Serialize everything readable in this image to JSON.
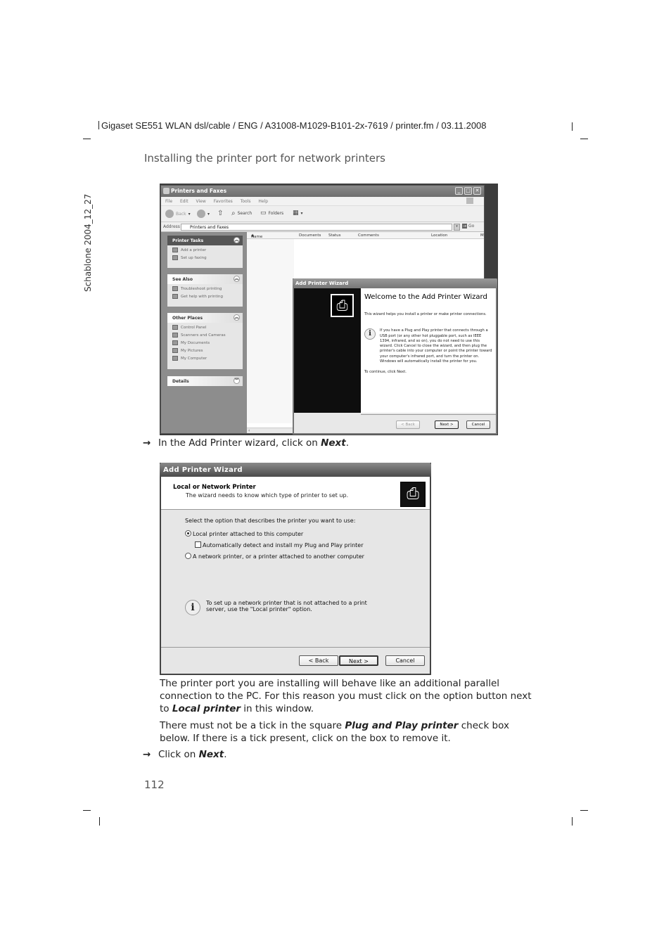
{
  "page_header": "Gigaset SE551 WLAN dsl/cable / ENG / A31008-M1029-B101-2x-7619 / printer.fm / 03.11.2008",
  "side_label": "Schablone 2004_12_27",
  "section_title": "Installing the printer port for network printers",
  "explorer": {
    "window_title": "Printers and Faxes",
    "menu": [
      "File",
      "Edit",
      "View",
      "Favorites",
      "Tools",
      "Help"
    ],
    "toolbar": {
      "back": "Back",
      "search": "Search",
      "folders": "Folders"
    },
    "address_label": "Address",
    "address_value": "Printers and Faxes",
    "go_label": "Go",
    "columns": [
      "Name",
      "Documents",
      "Status",
      "Comments",
      "Location",
      "M"
    ],
    "task_panes": [
      {
        "title": "Printer Tasks",
        "items": [
          "Add a printer",
          "Set up faxing"
        ]
      },
      {
        "title": "See Also",
        "items": [
          "Troubleshoot printing",
          "Get help with printing"
        ]
      },
      {
        "title": "Other Places",
        "items": [
          "Control Panel",
          "Scanners and Cameras",
          "My Documents",
          "My Pictures",
          "My Computer"
        ]
      },
      {
        "title": "Details",
        "items": []
      }
    ]
  },
  "welcome_wizard": {
    "title": "Add Printer Wizard",
    "heading": "Welcome to the Add Printer Wizard",
    "intro": "This wizard helps you install a printer or make printer connections.",
    "info": "If you have a Plug and Play printer that connects through a USB port (or any other hot pluggable port, such as IEEE 1394, infrared, and so on), you do not need to use this wizard. Click Cancel to close the wizard, and then plug the printer's cable into your computer or point the printer toward your computer's infrared port, and turn the printer on. Windows will automatically install the printer for you.",
    "continue": "To continue, click Next.",
    "buttons": {
      "back": "< Back",
      "next": "Next >",
      "cancel": "Cancel"
    }
  },
  "step1": {
    "prefix": "In the Add Printer wizard, click on ",
    "bold": "Next",
    "suffix": "."
  },
  "local_wizard": {
    "title": "Add Printer Wizard",
    "heading": "Local or Network Printer",
    "subheading": "The wizard needs to know which type of printer to set up.",
    "prompt": "Select the option that describes the printer you want to use:",
    "options": [
      {
        "label": "Local printer attached to this computer",
        "selected": true
      },
      {
        "label": "A network printer, or a printer attached to another computer",
        "selected": false
      }
    ],
    "checkbox": {
      "label": "Automatically detect and install my Plug and Play printer",
      "checked": false
    },
    "info": "To set up a network printer that is not attached to a print server, use the \"Local printer\" option.",
    "buttons": {
      "back": "< Back",
      "next": "Next >",
      "cancel": "Cancel"
    }
  },
  "para1": {
    "text": "The printer port you are installing will behave like an additional parallel connection to the PC. For this reason you must click on the option button next to ",
    "bold": "Local printer",
    "suffix": " in this window."
  },
  "para2": {
    "prefix": "There must not be a tick in the square ",
    "bold": "Plug and Play printer",
    "suffix": " check box below. If there is a tick present, click on the box to remove it."
  },
  "step2": {
    "prefix": "Click on ",
    "bold": "Next",
    "suffix": "."
  },
  "page_number": "112"
}
